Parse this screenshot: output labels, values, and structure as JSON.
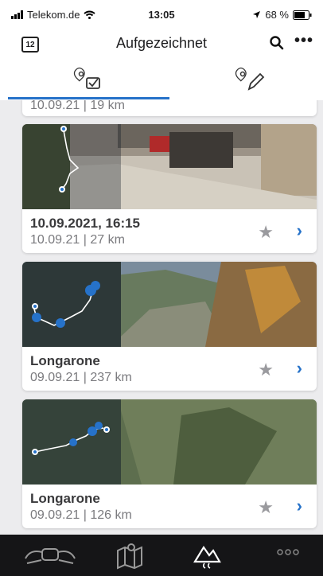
{
  "status": {
    "carrier": "Telekom.de",
    "time": "13:05",
    "battery": "68 %"
  },
  "nav": {
    "title": "Aufgezeichnet",
    "calendar_day": "12"
  },
  "tabs": [
    {
      "name": "recorded"
    },
    {
      "name": "planned"
    }
  ],
  "tracks": [
    {
      "title": "",
      "sub": "10.09.21 | 19 km"
    },
    {
      "title": "10.09.2021, 16:15",
      "sub": "10.09.21 | 27 km"
    },
    {
      "title": "Longarone",
      "sub": "09.09.21 | 237 km"
    },
    {
      "title": "Longarone",
      "sub": "09.09.21 | 126 km"
    }
  ],
  "colors": {
    "accent": "#2672c9",
    "bottombar": "#151517"
  },
  "bottom_nav": [
    "motorbike-icon",
    "map-icon",
    "mountains-icon",
    "more-icon"
  ]
}
